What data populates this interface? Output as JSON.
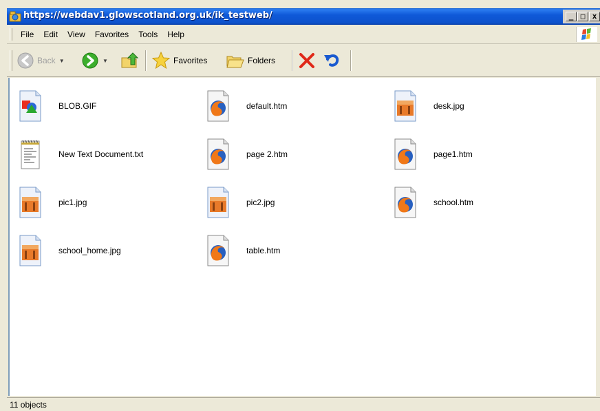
{
  "window": {
    "title": "https://webdav1.glowscotland.org.uk/ik_testweb/",
    "minimize": "_",
    "maximize": "□",
    "close": "x"
  },
  "menu": {
    "items": [
      "File",
      "Edit",
      "View",
      "Favorites",
      "Tools",
      "Help"
    ]
  },
  "toolbar": {
    "back_label": "Back",
    "favorites_label": "Favorites",
    "folders_label": "Folders"
  },
  "files": [
    {
      "name": "BLOB.GIF",
      "icon": "gif-file-icon"
    },
    {
      "name": "default.htm",
      "icon": "firefox-html-file-icon"
    },
    {
      "name": "desk.jpg",
      "icon": "jpg-file-icon"
    },
    {
      "name": "New Text Document.txt",
      "icon": "text-file-icon"
    },
    {
      "name": "page 2.htm",
      "icon": "firefox-html-file-icon"
    },
    {
      "name": "page1.htm",
      "icon": "firefox-html-file-icon"
    },
    {
      "name": "pic1.jpg",
      "icon": "jpg-file-icon"
    },
    {
      "name": "pic2.jpg",
      "icon": "jpg-file-icon"
    },
    {
      "name": "school.htm",
      "icon": "firefox-html-file-icon"
    },
    {
      "name": "school_home.jpg",
      "icon": "jpg-file-icon"
    },
    {
      "name": "table.htm",
      "icon": "firefox-html-file-icon"
    }
  ],
  "status": {
    "text": "11 objects"
  },
  "colors": {
    "titlebar": "#0d52cc",
    "chrome": "#ece9d8",
    "content_bg": "#ffffff"
  }
}
